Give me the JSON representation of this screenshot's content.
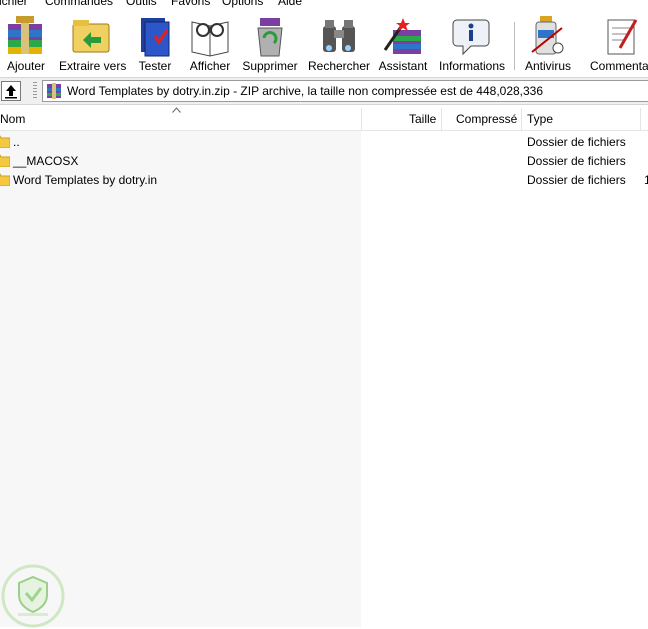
{
  "menu": [
    "ichier",
    "Commandes",
    "Outils",
    "Favoris",
    "Options",
    "Aide"
  ],
  "toolbar": {
    "buttons": [
      {
        "label": "Ajouter",
        "icon": "add-archive-icon"
      },
      {
        "label": "Extraire vers",
        "icon": "extract-to-icon"
      },
      {
        "label": "Tester",
        "icon": "test-icon"
      },
      {
        "label": "Afficher",
        "icon": "view-icon"
      },
      {
        "label": "Supprimer",
        "icon": "delete-icon"
      },
      {
        "label": "Rechercher",
        "icon": "find-icon"
      },
      {
        "label": "Assistant",
        "icon": "wizard-icon"
      },
      {
        "label": "Informations",
        "icon": "info-icon"
      },
      {
        "label": "Antivirus",
        "icon": "antivirus-icon"
      },
      {
        "label": "Commentaire",
        "icon": "comment-icon"
      }
    ]
  },
  "address": {
    "text": "Word Templates by dotry.in.zip - ZIP archive, la taille non compressée est de 448,028,336"
  },
  "columns": {
    "name": "Nom",
    "size": "Taille",
    "packed": "Compressé",
    "type": "Type"
  },
  "files": [
    {
      "name": "..",
      "type": "Dossier de fichiers",
      "extra": ""
    },
    {
      "name": "__MACOSX",
      "type": "Dossier de fichiers",
      "extra": ""
    },
    {
      "name": "Word Templates by dotry.in",
      "type": "Dossier de fichiers",
      "extra": "1"
    }
  ],
  "colors": {
    "folder": "#f5c842",
    "left_pane": "#f7f7f7",
    "watermark": "#6fbf5a"
  }
}
